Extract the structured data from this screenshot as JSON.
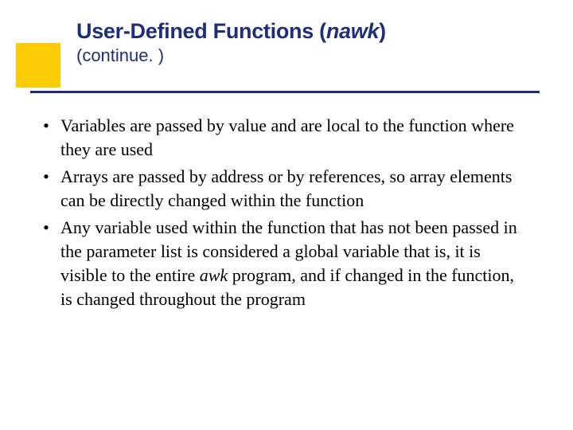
{
  "slide": {
    "title_main": "User-Defined Functions (",
    "title_italic": "nawk",
    "title_close": ")",
    "subtitle": "(continue. )",
    "bullets": [
      {
        "text": "Variables are passed by value and are local to the function where they are used"
      },
      {
        "text": "Arrays are passed by address or by references, so array elements can be directly changed within the function"
      },
      {
        "prefix": "Any variable used within the function that has not been passed in the parameter list is considered a global variable that is, it is visible to the entire ",
        "italic": "awk",
        "suffix": " program, and if changed in the function, is changed throughout the program"
      }
    ]
  }
}
